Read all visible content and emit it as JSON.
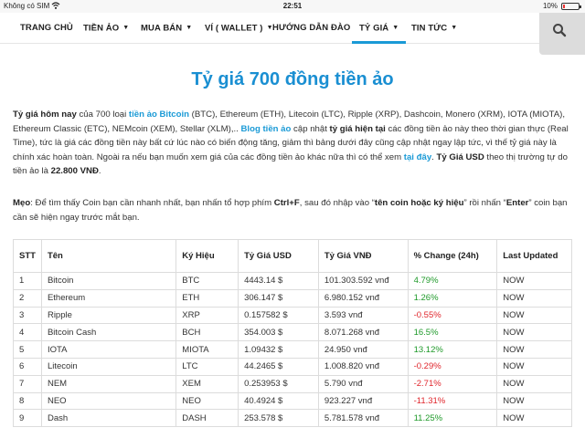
{
  "status_bar": {
    "carrier": "Không có SIM",
    "time": "22:51",
    "battery": "10%",
    "battery_level": 0.1
  },
  "nav": {
    "items": [
      {
        "label": "TRANG CHỦ",
        "chevron": false
      },
      {
        "label": "TIỀN ẢO",
        "chevron": true
      },
      {
        "label": "MUA BÁN",
        "chevron": true
      },
      {
        "label": "VÍ ( WALLET )",
        "chevron": true
      },
      {
        "label": "HƯỚNG DẪN ĐÀO",
        "chevron": false
      },
      {
        "label": "TỶ GIÁ",
        "chevron": true,
        "active": true
      },
      {
        "label": "TIN TỨC",
        "chevron": true
      }
    ],
    "search_icon": "search-icon"
  },
  "page": {
    "title": "Tỷ giá 700 đồng tiền ảo",
    "intro": {
      "s1": "Tỷ giá hôm nay",
      "s2": " của 700 loại ",
      "s3": "tiền ảo Bitcoin",
      "s4": " (BTC), Ethereum (ETH), Litecoin (LTC), Ripple (XRP), Dashcoin, Monero (XRM), IOTA (MIOTA), Ethereum Classic (ETC), NEMcoin (XEM), Stellar (XLM),.. ",
      "s5": "Blog tiền ảo",
      "s6": " cập nhật ",
      "s7": "tỷ giá hiện tại",
      "s8": " các đồng tiền ảo này theo thời gian thực (Real Time), tức là giá các đồng tiền này bất cứ lúc nào có biến động tăng, giảm thì bảng dưới đây cũng cập nhật ngay lập tức, vì thế tỷ giá này là chính xác hoàn toàn. Ngoài ra nếu bạn muốn xem giá của các đồng tiền ảo khác nữa thì có thể xem ",
      "s9": "tại đây",
      "s10": ". ",
      "s11": "Tỷ Giá USD",
      "s12": " theo thị trường tự do tiền ảo là ",
      "s13": "22.800 VNĐ",
      "s14": "."
    },
    "tip": {
      "s1": "Mẹo",
      "s2": ": Để tìm thấy Coin bạn cần nhanh nhất, bạn nhấn tổ hợp phím ",
      "s3": "Ctrl+F",
      "s4": ", sau đó nhập vào “",
      "s5": "tên coin hoặc ký hiệu",
      "s6": "” rồi nhấn “",
      "s7": "Enter",
      "s8": "” coin bạn cần sẽ hiện ngay trước mắt bạn."
    }
  },
  "table": {
    "headers": [
      "STT",
      "Tên",
      "Ký Hiệu",
      "Tỷ Giá USD",
      "Tỷ Giá VNĐ",
      "% Change (24h)",
      "Last Updated"
    ],
    "rows": [
      {
        "stt": "1",
        "name": "Bitcoin",
        "symbol": "BTC",
        "usd": "4443.14 $",
        "vnd": "101.303.592 vnđ",
        "change": "4.79%",
        "updated": "NOW"
      },
      {
        "stt": "2",
        "name": "Ethereum",
        "symbol": "ETH",
        "usd": "306.147 $",
        "vnd": "6.980.152 vnđ",
        "change": "1.26%",
        "updated": "NOW"
      },
      {
        "stt": "3",
        "name": "Ripple",
        "symbol": "XRP",
        "usd": "0.157582 $",
        "vnd": "3.593 vnđ",
        "change": "-0.55%",
        "updated": "NOW"
      },
      {
        "stt": "4",
        "name": "Bitcoin Cash",
        "symbol": "BCH",
        "usd": "354.003 $",
        "vnd": "8.071.268 vnđ",
        "change": "16.5%",
        "updated": "NOW"
      },
      {
        "stt": "5",
        "name": "IOTA",
        "symbol": "MIOTA",
        "usd": "1.09432 $",
        "vnd": "24.950 vnđ",
        "change": "13.12%",
        "updated": "NOW"
      },
      {
        "stt": "6",
        "name": "Litecoin",
        "symbol": "LTC",
        "usd": "44.2465 $",
        "vnd": "1.008.820 vnđ",
        "change": "-0.29%",
        "updated": "NOW"
      },
      {
        "stt": "7",
        "name": "NEM",
        "symbol": "XEM",
        "usd": "0.253953 $",
        "vnd": "5.790 vnđ",
        "change": "-2.71%",
        "updated": "NOW"
      },
      {
        "stt": "8",
        "name": "NEO",
        "symbol": "NEO",
        "usd": "40.4924 $",
        "vnd": "923.227 vnđ",
        "change": "-11.31%",
        "updated": "NOW"
      },
      {
        "stt": "9",
        "name": "Dash",
        "symbol": "DASH",
        "usd": "253.578 $",
        "vnd": "5.781.578 vnđ",
        "change": "11.25%",
        "updated": "NOW"
      }
    ]
  },
  "colors": {
    "accent": "#1a9ad6",
    "title": "#1a8fd2",
    "positive": "#1f9a2a",
    "negative": "#e0262c"
  }
}
